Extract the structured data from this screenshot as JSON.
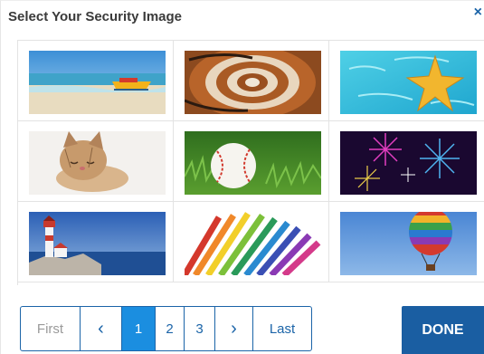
{
  "dialog": {
    "title": "Select Your Security Image",
    "close_glyph": "×"
  },
  "images": [
    {
      "name": "beach-boat-image"
    },
    {
      "name": "spiral-staircase-image"
    },
    {
      "name": "starfish-image"
    },
    {
      "name": "kitten-image"
    },
    {
      "name": "baseball-image"
    },
    {
      "name": "fireworks-image"
    },
    {
      "name": "lighthouse-image"
    },
    {
      "name": "colored-pencils-image"
    },
    {
      "name": "hot-air-balloon-image"
    }
  ],
  "pagination": {
    "first_label": "First",
    "prev_glyph": "‹",
    "pages": [
      "1",
      "2",
      "3"
    ],
    "current_page": "1",
    "next_glyph": "›",
    "last_label": "Last"
  },
  "done_label": "DONE",
  "colors": {
    "accent": "#1b64a8",
    "active_page": "#1b8ee0",
    "done_button": "#1a5ea2"
  }
}
